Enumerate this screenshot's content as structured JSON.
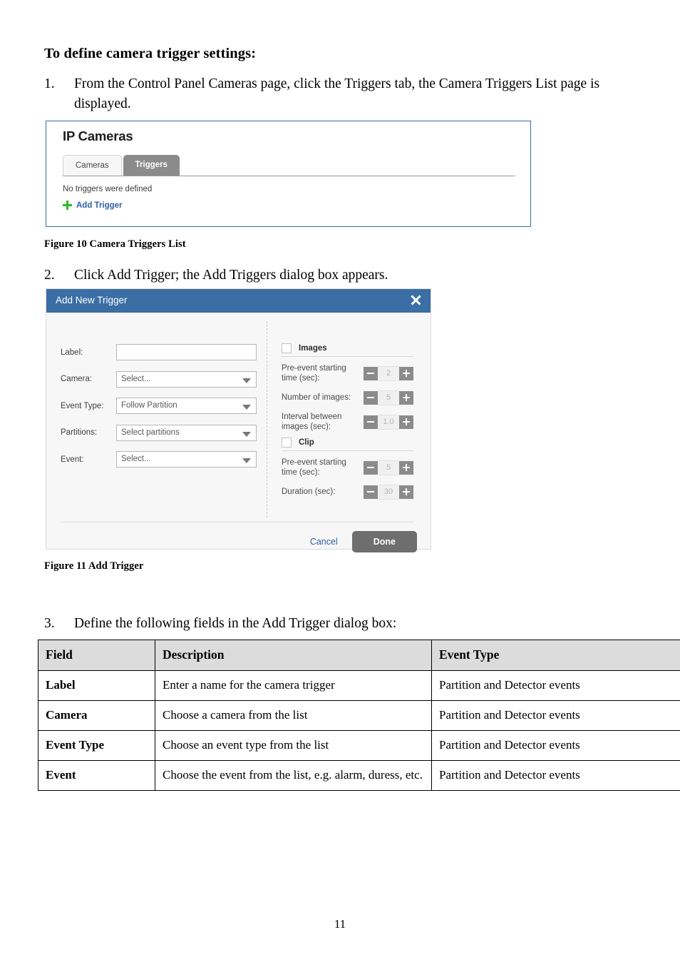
{
  "document": {
    "heading": "To define camera trigger settings:",
    "page_number": "11",
    "steps": [
      {
        "num": "1.",
        "text": "From the Control Panel Cameras page, click the Triggers tab, the Camera Triggers List page is displayed."
      },
      {
        "num": "2.",
        "text": "Click Add Trigger; the Add Triggers dialog box appears."
      },
      {
        "num": "3.",
        "text": "Define the following fields in the Add Trigger dialog box:"
      }
    ],
    "figure_captions": {
      "figure_10": "Figure 10 Camera Triggers List",
      "figure_11": "Figure 11 Add Trigger"
    }
  },
  "figure_10": {
    "title": "IP Cameras",
    "tabs": [
      {
        "label": "Cameras",
        "active": false
      },
      {
        "label": "Triggers",
        "active": true
      }
    ],
    "empty_text": "No triggers were defined",
    "add_trigger_label": "Add Trigger",
    "colors": {
      "border": "#3a6ea5",
      "active_tab": "#8b8b8b",
      "plus_icon": "#2aba2a",
      "link": "#2f5fa8"
    }
  },
  "figure_11": {
    "title": "Add New Trigger",
    "close_label": "✕",
    "fields": [
      {
        "label": "Label:",
        "value": "",
        "type": "text"
      },
      {
        "label": "Camera:",
        "value": "Select...",
        "type": "select"
      },
      {
        "label": "Event Type:",
        "value": "Follow Partition",
        "type": "select"
      },
      {
        "label": "Partitions:",
        "value": "Select partitions",
        "type": "select"
      },
      {
        "label": "Event:",
        "value": "Select...",
        "type": "select"
      }
    ],
    "sections": [
      {
        "title": "Images",
        "checked": false,
        "rows": [
          {
            "label": "Pre-event starting time (sec):",
            "value": "2"
          },
          {
            "label": "Number of images:",
            "value": "5"
          },
          {
            "label": "Interval between images (sec):",
            "value": "1.0"
          }
        ]
      },
      {
        "title": "Clip",
        "checked": false,
        "rows": [
          {
            "label": "Pre-event starting time (sec):",
            "value": "5"
          },
          {
            "label": "Duration (sec):",
            "value": "30"
          }
        ]
      }
    ],
    "footer": {
      "cancel_label": "Cancel",
      "done_label": "Done"
    },
    "colors": {
      "titlebar": "#3a6ea5",
      "done_button": "#6e6e6e",
      "stepper_button": "#8b8b8b",
      "link": "#2f5fa8"
    }
  },
  "field_table": {
    "headers": [
      "Field",
      "Description",
      "Event Type"
    ],
    "rows": [
      [
        "Label",
        "Enter a name for the camera trigger",
        "Partition and Detector events"
      ],
      [
        "Camera",
        "Choose a camera from the list",
        "Partition and Detector events"
      ],
      [
        "Event Type",
        "Choose an event type from the list",
        "Partition and Detector events"
      ],
      [
        "Event",
        "Choose the event from the list, e.g. alarm, duress, etc.",
        "Partition and Detector events"
      ]
    ]
  }
}
